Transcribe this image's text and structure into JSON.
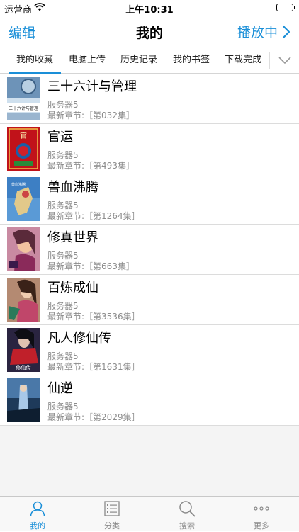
{
  "status_bar": {
    "carrier": "运营商",
    "time": "上午10:31"
  },
  "nav": {
    "edit": "编辑",
    "title": "我的",
    "playing": "播放中"
  },
  "tabs": [
    {
      "label": "我的收藏",
      "active": true
    },
    {
      "label": "电脑上传",
      "active": false
    },
    {
      "label": "历史记录",
      "active": false
    },
    {
      "label": "我的书签",
      "active": false
    },
    {
      "label": "下载完成",
      "active": false
    }
  ],
  "books": [
    {
      "title": "三十六计与管理",
      "server": "服务器5",
      "chapter": "最新章节:［第032集］",
      "cover_text": "三十六计与管理"
    },
    {
      "title": "官运",
      "server": "服务器5",
      "chapter": "最新章节:［第493集］",
      "cover_text": "官"
    },
    {
      "title": "兽血沸腾",
      "server": "服务器5",
      "chapter": "最新章节:［第1264集］",
      "cover_text": "兽血沸腾"
    },
    {
      "title": "修真世界",
      "server": "服务器5",
      "chapter": "最新章节:［第663集］",
      "cover_text": ""
    },
    {
      "title": "百炼成仙",
      "server": "服务器5",
      "chapter": "最新章节:［第3536集］",
      "cover_text": ""
    },
    {
      "title": "凡人修仙传",
      "server": "服务器5",
      "chapter": "最新章节:［第1631集］",
      "cover_text": "修仙传"
    },
    {
      "title": "仙逆",
      "server": "服务器5",
      "chapter": "最新章节:［第2029集］",
      "cover_text": ""
    }
  ],
  "bottom_tabs": [
    {
      "label": "我的",
      "icon": "person-icon",
      "active": true
    },
    {
      "label": "分类",
      "icon": "list-icon",
      "active": false
    },
    {
      "label": "搜索",
      "icon": "search-icon",
      "active": false
    },
    {
      "label": "更多",
      "icon": "more-icon",
      "active": false
    }
  ],
  "colors": {
    "accent": "#1a8fd8",
    "inactive": "#8a8a8a"
  }
}
